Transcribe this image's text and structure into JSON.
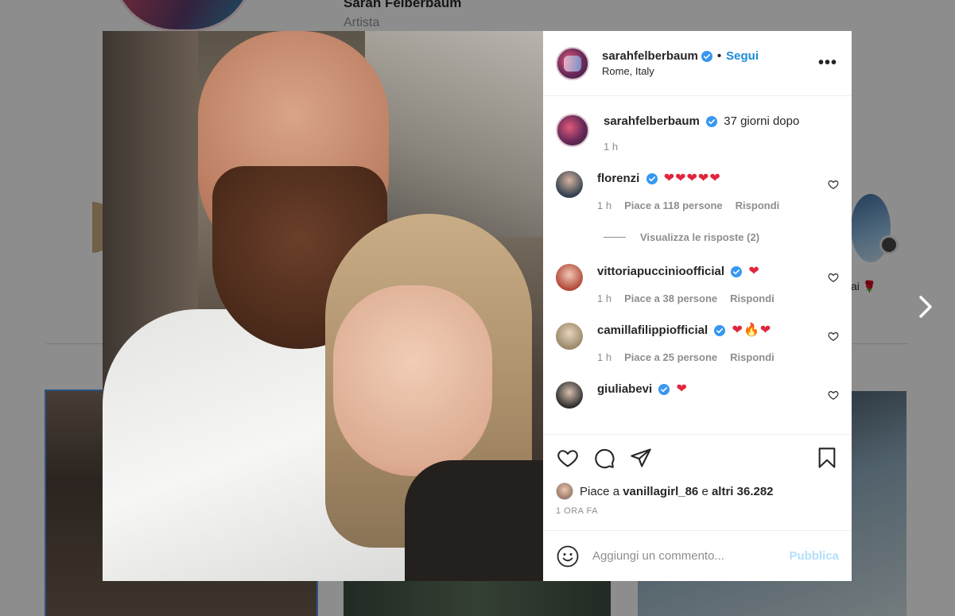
{
  "background": {
    "profile_name": "Sarah Felberbaum",
    "profile_role": "Artista",
    "story_label": "ai 🌹"
  },
  "post": {
    "username": "sarahfelberbaum",
    "separator": "•",
    "follow_label": "Segui",
    "location": "Rome, Italy",
    "more_label": "•••",
    "caption": {
      "username": "sarahfelberbaum",
      "text": "37 giorni dopo",
      "time": "1 h"
    },
    "comments": [
      {
        "username": "florenzi",
        "text": "❤❤❤❤❤",
        "time": "1 h",
        "likes": "Piace a 118 persone",
        "reply": "Rispondi",
        "avatar_color": "#33414f"
      },
      {
        "username": "vittoriapuccinioofficial",
        "text": "❤",
        "time": "1 h",
        "likes": "Piace a 38 persone",
        "reply": "Rispondi",
        "avatar_color": "#b24a3a"
      },
      {
        "username": "camillafilippiofficial",
        "text": "❤🔥❤",
        "time": "1 h",
        "likes": "Piace a 25 persone",
        "reply": "Rispondi",
        "avatar_color": "#9a8a6a"
      },
      {
        "username": "giuliabevi",
        "text": "❤",
        "time": "",
        "likes": "",
        "reply": "",
        "avatar_color": "#2e2e2e"
      }
    ],
    "view_replies": "Visualizza le risposte (2)",
    "liked_by_prefix": "Piace a",
    "liked_by_user": "vanillagirl_86",
    "liked_by_mid": "e",
    "liked_by_others": "altri 36.282",
    "posted_time": "1 ORA FA",
    "comment_placeholder": "Aggiungi un commento...",
    "publish_label": "Pubblica"
  },
  "colors": {
    "accent_blue": "#1c8bd8",
    "heart_red": "#e0263d",
    "publish_disabled": "#b2dffc",
    "muted_text": "#8e8e8e"
  },
  "icons": [
    "verified-badge-icon",
    "heart-icon",
    "comment-icon",
    "share-icon",
    "bookmark-icon",
    "emoji-icon",
    "chevron-right-icon",
    "more-icon"
  ]
}
